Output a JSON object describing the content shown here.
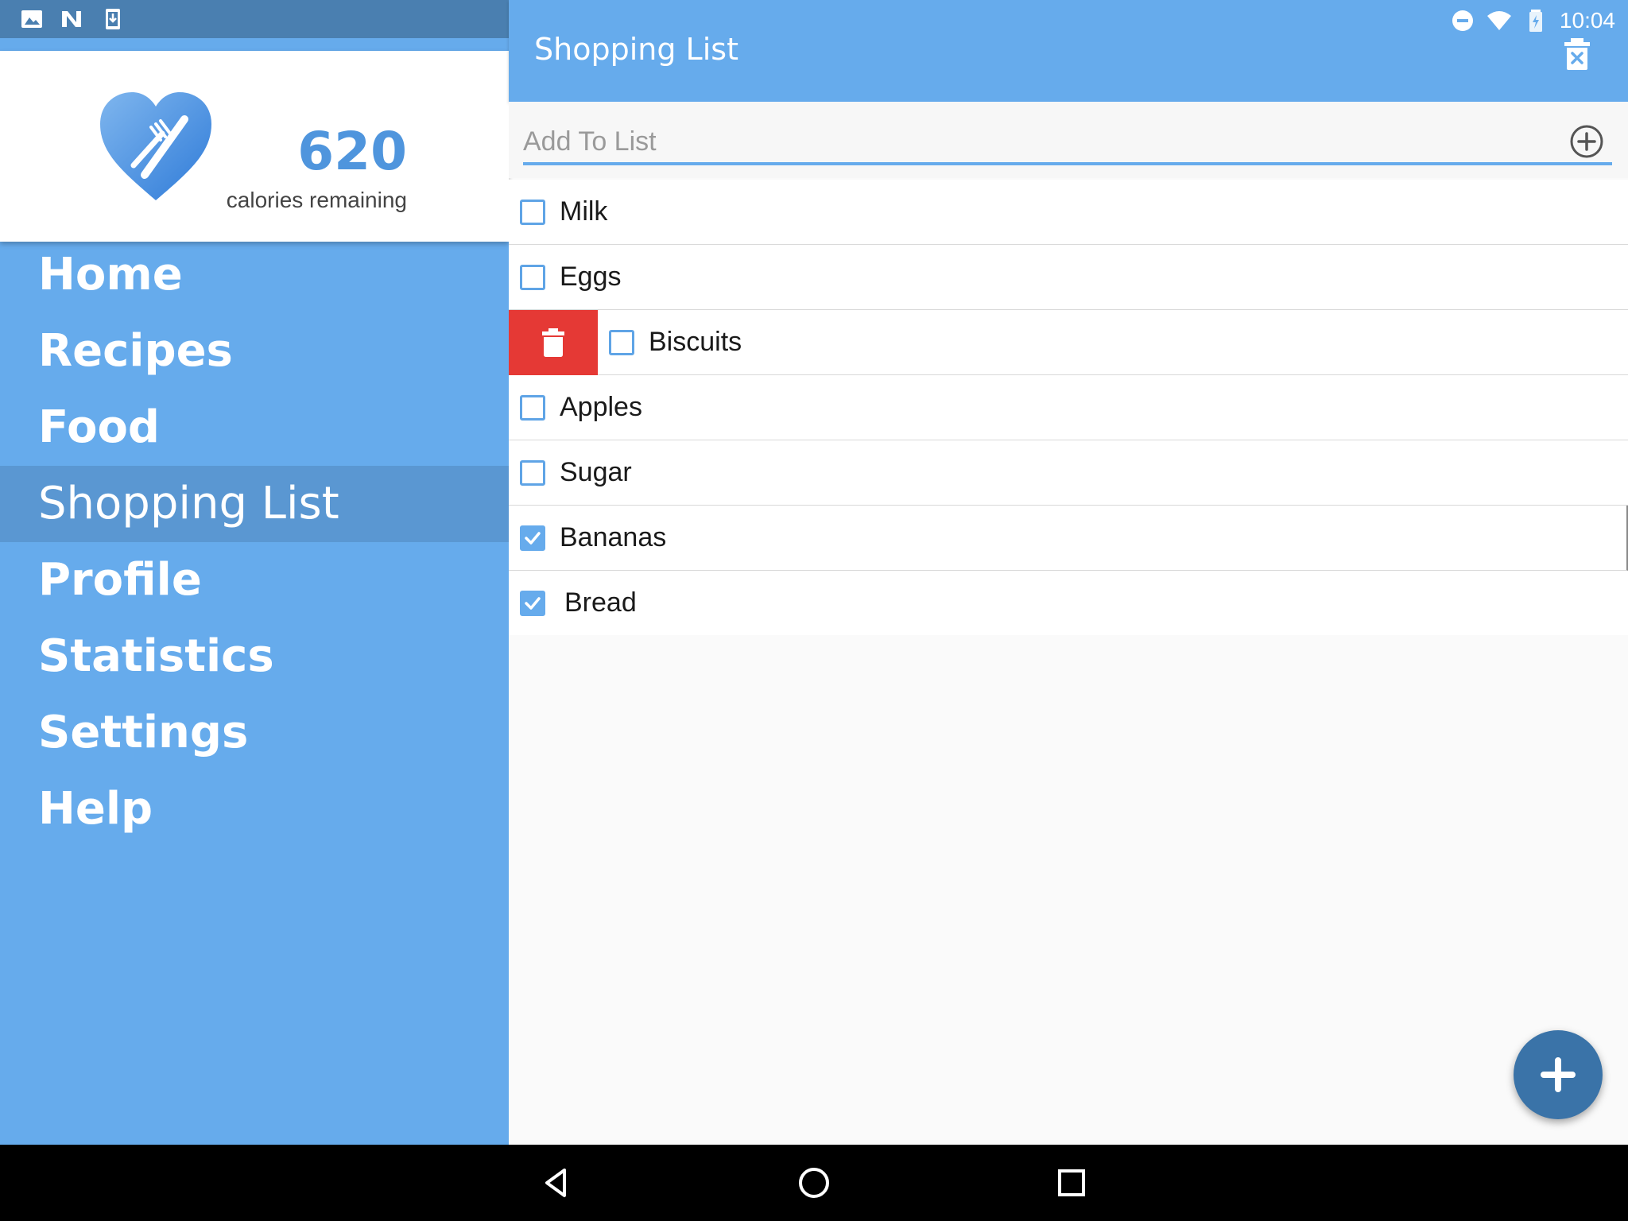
{
  "status_bar": {
    "left_icons": [
      "image-icon",
      "n-logo-icon",
      "download-icon"
    ],
    "right_icons": [
      "do-not-disturb-icon",
      "wifi-icon",
      "battery-charging-icon"
    ],
    "time": "10:04"
  },
  "drawer": {
    "logo": "heart-fork-knife-logo",
    "calories_value": "620",
    "calories_label": "calories remaining",
    "items": [
      {
        "label": "Home",
        "active": false
      },
      {
        "label": "Recipes",
        "active": false
      },
      {
        "label": "Food",
        "active": false
      },
      {
        "label": "Shopping List",
        "active": true
      },
      {
        "label": "Profile",
        "active": false
      },
      {
        "label": "Statistics",
        "active": false
      },
      {
        "label": "Settings",
        "active": false
      },
      {
        "label": "Help",
        "active": false
      }
    ]
  },
  "toolbar": {
    "title": "Shopping List",
    "clear_icon": "delete-list-icon"
  },
  "add_field": {
    "value": "",
    "placeholder": "Add To List",
    "add_icon": "add-circle-icon"
  },
  "shopping_items": [
    {
      "label": "Milk",
      "checked": false
    },
    {
      "label": "Eggs",
      "checked": false
    },
    {
      "label": "Biscuits",
      "checked": false,
      "swiped_delete": true
    },
    {
      "label": "Apples",
      "checked": false
    },
    {
      "label": "Sugar",
      "checked": false
    },
    {
      "label": "Bananas",
      "checked": true
    },
    {
      "label": "Bread",
      "checked": true
    }
  ],
  "fab": {
    "icon": "plus-icon"
  },
  "nav_bar": {
    "icons": [
      "back-icon",
      "home-icon",
      "recents-icon"
    ]
  },
  "colors": {
    "primary": "#66abec",
    "primary_dark": "#4a7fb0",
    "active_item": "#5a97d2",
    "delete_red": "#e53935",
    "fab": "#3a73a8"
  }
}
